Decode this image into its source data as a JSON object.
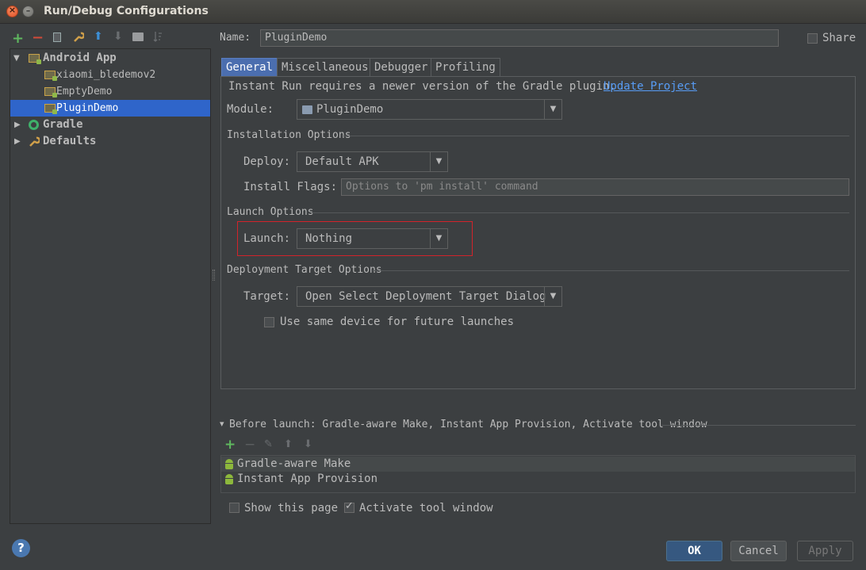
{
  "window": {
    "title": "Run/Debug Configurations",
    "close_glyph": "×",
    "min_glyph": "–"
  },
  "toolbar": {
    "icons": [
      "add-icon",
      "remove-icon",
      "copy-icon",
      "wrench-icon",
      "move-up-icon",
      "move-down-icon",
      "folder-icon",
      "sort-icon"
    ],
    "add": "+",
    "remove": "−",
    "up": "⬆",
    "down": "⬇"
  },
  "tree": {
    "items": [
      {
        "label": "Android App",
        "expanded": true
      },
      {
        "label": "xiaomi_bledemov2"
      },
      {
        "label": "EmptyDemo"
      },
      {
        "label": "PluginDemo",
        "selected": true
      },
      {
        "label": "Gradle",
        "expanded": false
      },
      {
        "label": "Defaults",
        "expanded": false
      }
    ],
    "expanded_arrow": "▼",
    "collapsed_arrow": "▶"
  },
  "form": {
    "name_label": "Name:",
    "name_value": "PluginDemo",
    "share_label": "Share",
    "share_checked": false
  },
  "tabs": [
    {
      "label": "General",
      "active": true
    },
    {
      "label": "Miscellaneous"
    },
    {
      "label": "Debugger"
    },
    {
      "label": "Profiling"
    }
  ],
  "general": {
    "instant_run_msg": "Instant Run requires a newer version of the Gradle plugin.",
    "update_link": "Update Project",
    "module_label": "Module:",
    "module_value": "PluginDemo",
    "installation_title": "Installation Options",
    "deploy_label": "Deploy:",
    "deploy_value": "Default APK",
    "install_flags_label": "Install Flags:",
    "install_flags_placeholder": "Options to 'pm install' command",
    "launch_title": "Launch Options",
    "launch_label": "Launch:",
    "launch_value": "Nothing",
    "deployment_title": "Deployment Target Options",
    "target_label": "Target:",
    "target_value": "Open Select Deployment Target Dialog",
    "same_device_label": "Use same device for future launches",
    "same_device_checked": false
  },
  "before_launch": {
    "header": "Before launch: Gradle-aware Make, Instant App Provision, Activate tool window",
    "collapse_glyph": "▾",
    "add": "+",
    "remove": "−",
    "edit": "✎",
    "up": "⬆",
    "down": "⬇",
    "items": [
      "Gradle-aware Make",
      "Instant App Provision"
    ]
  },
  "footer": {
    "show_page_label": "Show this page",
    "show_page_checked": false,
    "activate_label": "Activate tool window",
    "activate_checked": true,
    "ok": "OK",
    "cancel": "Cancel",
    "apply": "Apply",
    "help": "?"
  },
  "dropdown_glyph": "▼",
  "colors": {
    "background": "#3c3f41",
    "selection": "#2f65ca",
    "link": "#589df6",
    "highlight_box": "#d2232a",
    "ok_button": "#365880"
  }
}
